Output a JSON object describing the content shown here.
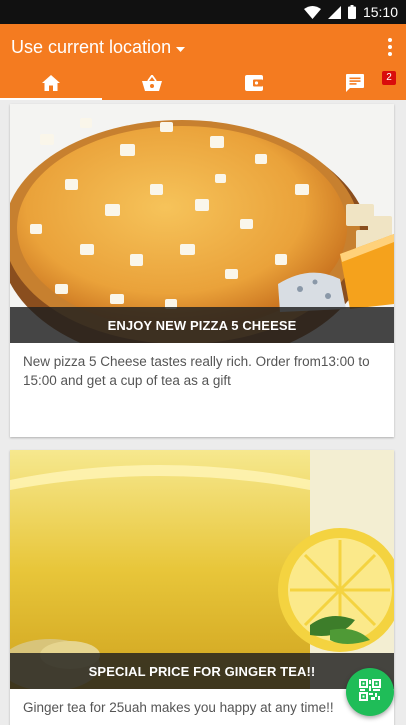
{
  "status_bar": {
    "time": "15:10",
    "icons": [
      "wifi-icon",
      "signal-icon",
      "battery-icon"
    ]
  },
  "app_bar": {
    "location_label": "Use current location",
    "icons": [
      "dropdown-arrow-icon",
      "overflow-menu-icon"
    ]
  },
  "tabs": [
    {
      "icon": "home-icon",
      "active": true
    },
    {
      "icon": "basket-icon",
      "active": false
    },
    {
      "icon": "wallet-icon",
      "active": false
    },
    {
      "icon": "messages-icon",
      "active": false,
      "badge": "2"
    }
  ],
  "cards": [
    {
      "image": "pizza-image",
      "caption": "ENJOY NEW PIZZA 5 CHEESE",
      "text": "New pizza 5 Cheese tastes really rich. Order from13:00 to 15:00 and get a cup of tea as a gift"
    },
    {
      "image": "ginger-tea-image",
      "caption": "SPECIAL PRICE FOR GINGER TEA!!",
      "text": "Ginger tea for 25uah makes you happy at any time!!"
    }
  ],
  "fab": {
    "icon": "qr-code-icon"
  },
  "colors": {
    "primary": "#f47b20",
    "fab": "#1fbd58",
    "badge": "#d90c0c",
    "status_bar": "#111111"
  }
}
